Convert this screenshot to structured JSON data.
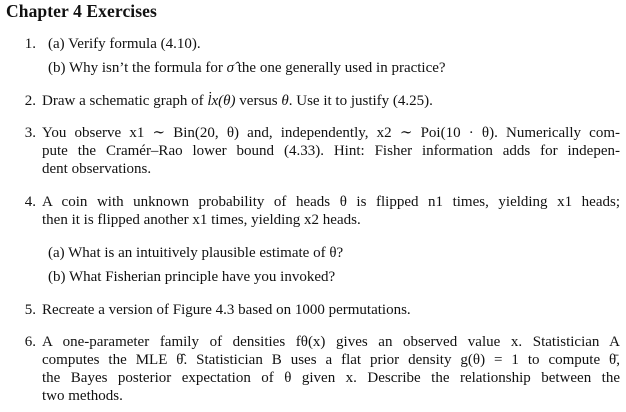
{
  "chapter_title": "Chapter 4 Exercises",
  "items": [
    {
      "number": "1.",
      "parts": [
        {
          "label": "(a)",
          "text": "Verify formula (4.10)."
        },
        {
          "label": "(b)",
          "text_pre": "Why isn’t the formula for ",
          "symbol": "σ̂",
          "text_post": " the one generally used in practice?"
        }
      ]
    },
    {
      "number": "2.",
      "text_pre": "Draw a schematic graph of ",
      "symbol": "l̇x(θ)",
      "text_mid": " versus ",
      "theta": "θ",
      "text_post": ". Use it to justify (4.25)."
    },
    {
      "number": "3.",
      "lines": [
        "You observe x1 ∼ Bin(20, θ) and, independently, x2 ∼ Poi(10 · θ). Numerically com-",
        "pute the Cramér–Rao lower bound (4.33). Hint: Fisher information adds for indepen-",
        "dent observations."
      ]
    },
    {
      "number": "4.",
      "lines": [
        "A coin with unknown probability of heads θ is flipped n1 times, yielding x1 heads;",
        "then it is flipped another x1 times, yielding x2 heads."
      ],
      "parts": [
        {
          "label": "(a)",
          "text": "What is an intuitively plausible estimate of θ?"
        },
        {
          "label": "(b)",
          "text": "What Fisherian principle have you invoked?"
        }
      ]
    },
    {
      "number": "5.",
      "text": "Recreate a version of Figure 4.3 based on 1000 permutations."
    },
    {
      "number": "6.",
      "lines": [
        "A one-parameter family of densities fθ(x) gives an observed value x. Statistician A",
        "computes the MLE θ̂. Statistician B uses a flat prior density g(θ) = 1 to compute θ̄,",
        "the Bayes posterior expectation of θ given x. Describe the relationship between the",
        "two methods."
      ]
    }
  ]
}
